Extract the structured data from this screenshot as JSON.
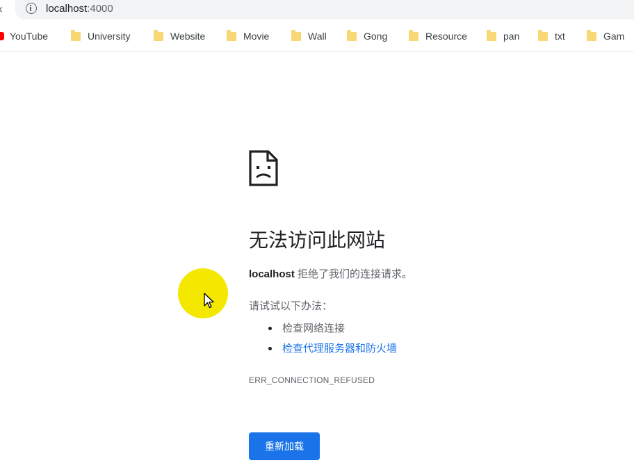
{
  "browser": {
    "address_bar": {
      "host": "localhost",
      "port": ":4000"
    },
    "bookmarks": [
      {
        "label": "YouTube",
        "icon": "youtube-icon"
      },
      {
        "label": "University",
        "icon": "folder-icon"
      },
      {
        "label": "Website",
        "icon": "folder-icon"
      },
      {
        "label": "Movie",
        "icon": "folder-icon"
      },
      {
        "label": "Wall",
        "icon": "folder-icon"
      },
      {
        "label": "Gong",
        "icon": "folder-icon"
      },
      {
        "label": "Resource",
        "icon": "folder-icon"
      },
      {
        "label": "pan",
        "icon": "folder-icon"
      },
      {
        "label": "txt",
        "icon": "folder-icon"
      },
      {
        "label": "Gam",
        "icon": "folder-icon"
      }
    ]
  },
  "error_page": {
    "icon": "sad-page-icon",
    "headline": "无法访问此网站",
    "summary_host": "localhost",
    "summary_text": " 拒绝了我们的连接请求。",
    "try_label": "请试试以下办法：",
    "suggestions": [
      {
        "label": "检查网络连接"
      },
      {
        "label": "检查代理服务器和防火墙"
      }
    ],
    "error_code": "ERR_CONNECTION_REFUSED",
    "reload_label": "重新加载"
  },
  "colors": {
    "accent": "#1a73e8",
    "cursor_highlight": "#f4e800"
  }
}
